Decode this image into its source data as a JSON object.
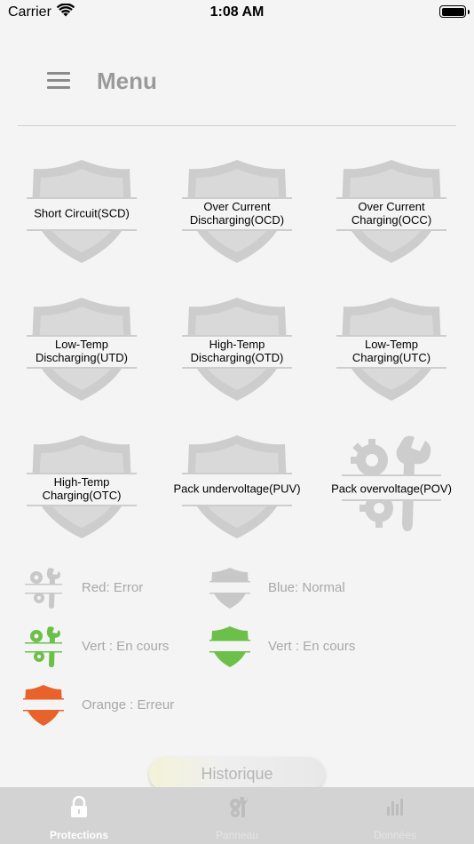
{
  "status_bar": {
    "carrier": "Carrier",
    "time": "1:08 AM"
  },
  "header": {
    "title": "Menu"
  },
  "protections": [
    {
      "label": "Short Circuit(SCD)",
      "icon": "shield-icon"
    },
    {
      "label": "Over Current\nDischarging(OCD)",
      "icon": "shield-icon"
    },
    {
      "label": "Over Current\nCharging(OCC)",
      "icon": "shield-icon"
    },
    {
      "label": "Low-Temp\nDischarging(UTD)",
      "icon": "shield-icon"
    },
    {
      "label": "High-Temp\nDischarging(OTD)",
      "icon": "shield-icon"
    },
    {
      "label": "Low-Temp\nCharging(UTC)",
      "icon": "shield-icon"
    },
    {
      "label": "High-Temp\nCharging(OTC)",
      "icon": "shield-icon"
    },
    {
      "label": "Pack undervoltage(PUV)",
      "icon": "shield-icon"
    },
    {
      "label": "Pack overvoltage(POV)",
      "icon": "tools-icon"
    }
  ],
  "legend": [
    {
      "text": "Red: Error",
      "icon": "tools-icon",
      "color": "#c8c8c8"
    },
    {
      "text": "Blue: Normal",
      "icon": "shield-icon",
      "color": "#c8c8c8"
    },
    {
      "text": "Vert : En cours",
      "icon": "tools-icon",
      "color": "#6cc04a"
    },
    {
      "text": "Vert : En cours",
      "icon": "shield-icon",
      "color": "#6cc04a"
    },
    {
      "text": "Orange : Erreur",
      "icon": "shield-icon",
      "color": "#e8622b"
    }
  ],
  "historique_label": "Historique",
  "tabs": [
    {
      "label": "Protections",
      "icon": "lock-icon",
      "active": true
    },
    {
      "label": "Panneau",
      "icon": "gear-tools-icon",
      "active": false
    },
    {
      "label": "Données",
      "icon": "bar-chart-icon",
      "active": false
    }
  ],
  "colors": {
    "inactive_gray": "#c8c8c8",
    "green": "#6cc04a",
    "orange": "#e8622b",
    "tab_bar": "#d3d3d3"
  }
}
